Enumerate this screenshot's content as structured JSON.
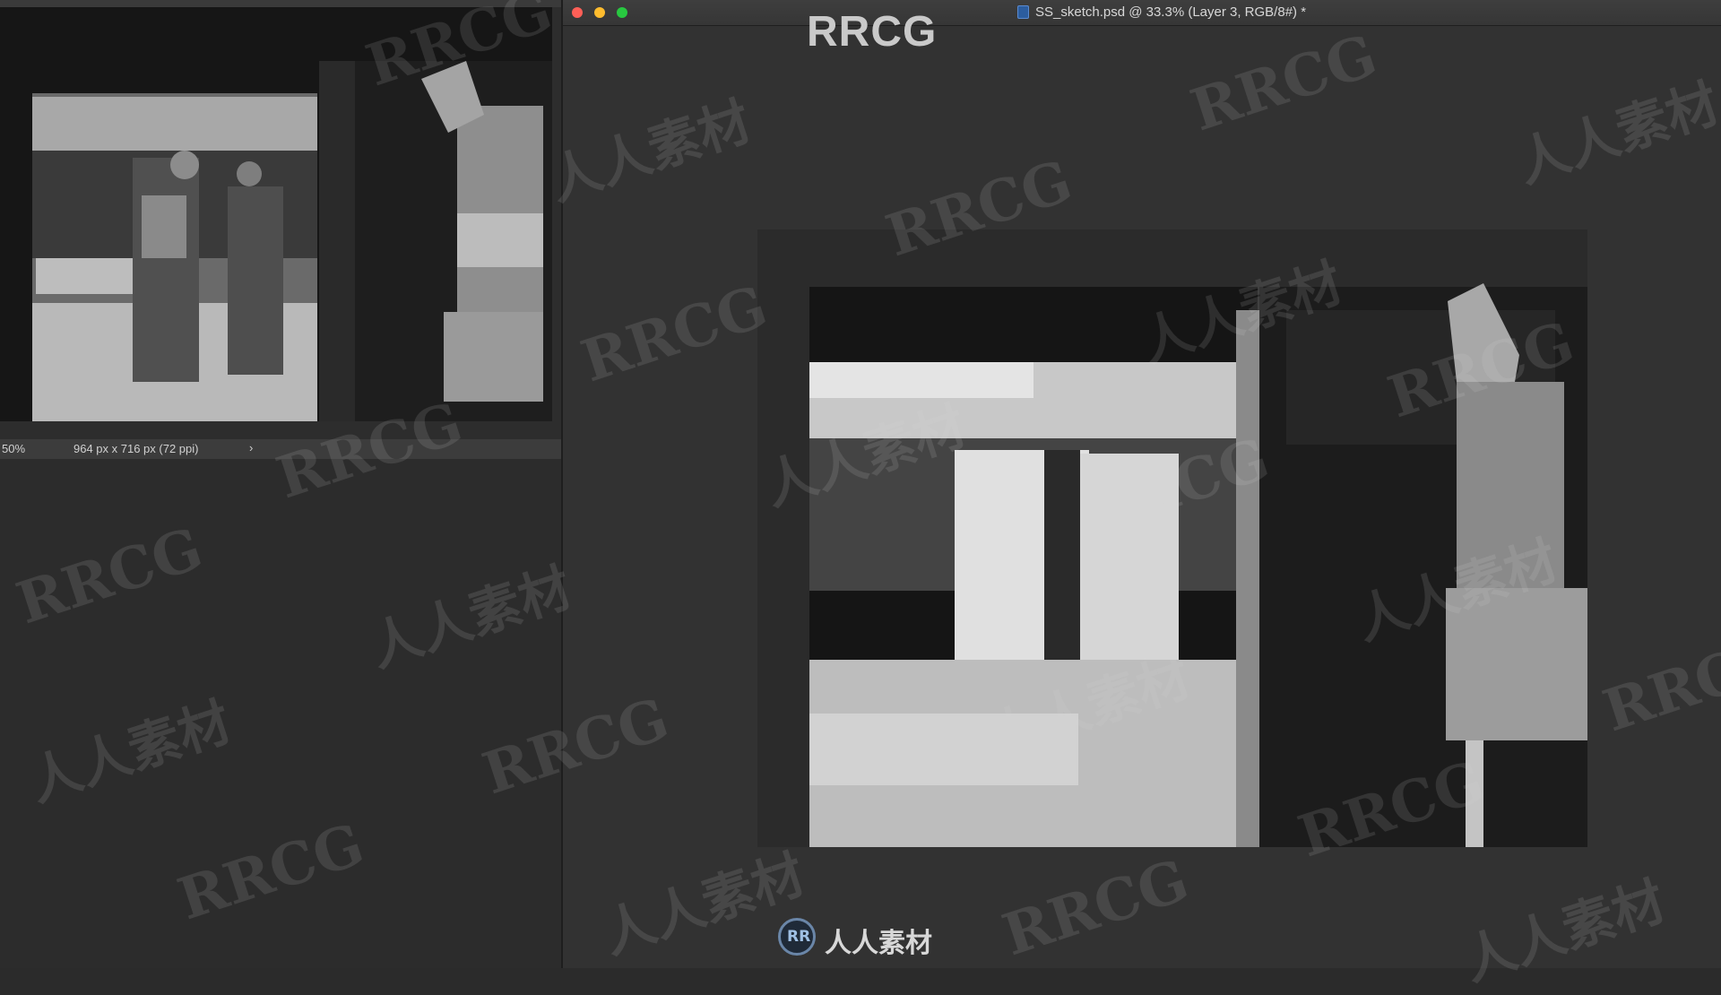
{
  "reference_panel": {
    "zoom": "50%",
    "dimensions": "964 px x 716 px (72 ppi)",
    "arrow_glyph": "›"
  },
  "document_window": {
    "title": "SS_sketch.psd @ 33.3% (Layer 3, RGB/8#) *"
  },
  "watermarks": {
    "top_label": "RRCG",
    "rrcg": "RRCG",
    "cn": "人人素材",
    "bottom_logo_text": "人人素材"
  }
}
